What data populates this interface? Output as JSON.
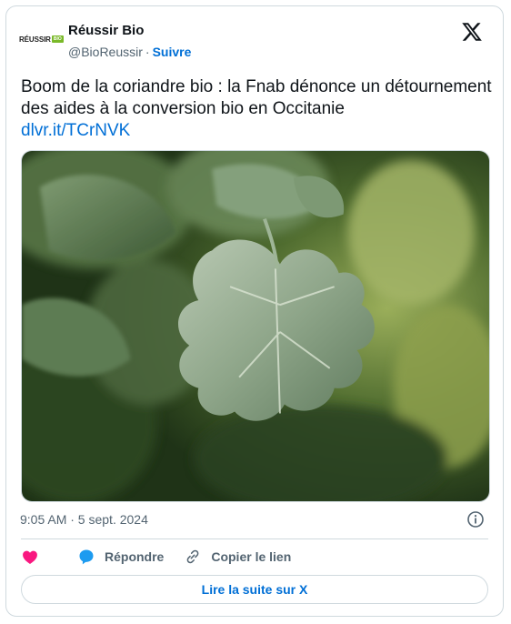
{
  "author": {
    "name": "Réussir Bio",
    "handle": "@BioReussir",
    "separator": "·",
    "follow_label": "Suivre",
    "avatar_text": "RÉUSSIR",
    "avatar_tag": "BIO"
  },
  "tweet": {
    "text": "Boom de la coriandre bio : la Fnab dénonce un détournement des aides à la conversion bio en Occitanie",
    "link": "dlvr.it/TCrNVK",
    "timestamp": "9:05 AM · 5 sept. 2024"
  },
  "actions": {
    "reply_label": "Répondre",
    "copy_label": "Copier le lien"
  },
  "read_more_label": "Lire la suite sur X",
  "colors": {
    "accent": "#006fd6",
    "like": "#f91880",
    "muted": "#536471",
    "border": "#cfd9de",
    "brand_green": "#7ab929"
  },
  "icons": [
    "x-logo-icon",
    "info-icon",
    "heart-icon",
    "reply-bubble-icon",
    "link-icon"
  ]
}
